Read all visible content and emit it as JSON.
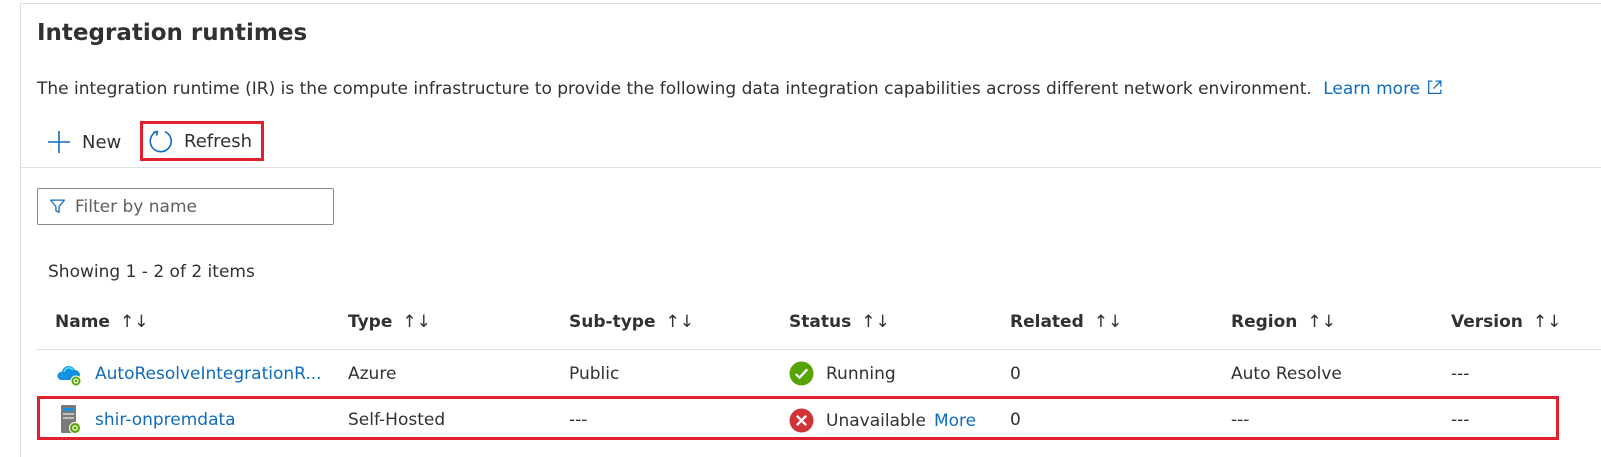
{
  "page": {
    "title": "Integration runtimes",
    "description": "The integration runtime (IR) is the compute infrastructure to provide the following data integration capabilities across different network environment.",
    "learn_more": "Learn more"
  },
  "toolbar": {
    "new_label": "New",
    "refresh_label": "Refresh"
  },
  "filter": {
    "placeholder": "Filter by name"
  },
  "summary": "Showing 1 - 2 of 2 items",
  "table": {
    "columns": [
      "Name",
      "Type",
      "Sub-type",
      "Status",
      "Related",
      "Region",
      "Version"
    ],
    "sort_glyph": "↑↓",
    "rows": [
      {
        "icon": "azure-cloud-ir-icon",
        "name": "AutoResolveIntegrationR...",
        "type": "Azure",
        "subtype": "Public",
        "status_icon": "check-circle-icon",
        "status": "Running",
        "related": "0",
        "region": "Auto Resolve",
        "version": "---"
      },
      {
        "icon": "self-hosted-server-icon",
        "name": "shir-onpremdata",
        "type": "Self-Hosted",
        "subtype": "---",
        "status_icon": "error-circle-icon",
        "status": "Unavailable",
        "status_link": "More",
        "related": "0",
        "region": "---",
        "version": "---"
      }
    ]
  },
  "colors": {
    "link": "#0f6cbd",
    "highlight_outline": "#e0202d",
    "success": "#57a300",
    "error": "#d13438"
  }
}
